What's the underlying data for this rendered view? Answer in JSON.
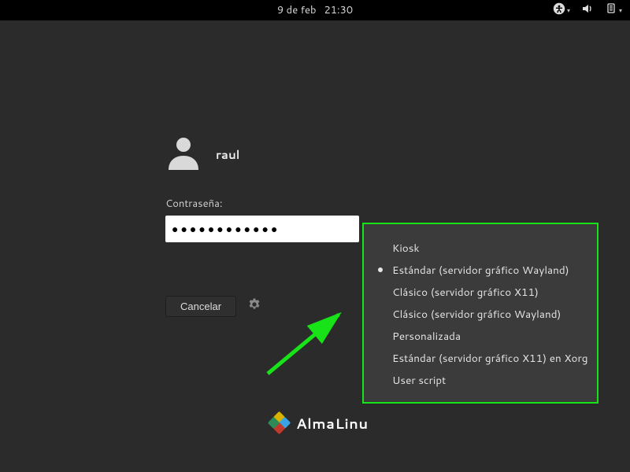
{
  "topbar": {
    "date": "9 de feb",
    "time": "21:30",
    "icons": {
      "a11y": "accessibility-icon",
      "volume": "volume-icon",
      "power": "power-menu-icon"
    }
  },
  "login": {
    "username": "raul",
    "password_label": "Contraseña:",
    "password_value": "●●●●●●●●●●●●",
    "cancel_label": "Cancelar"
  },
  "sessions": {
    "selected_index": 1,
    "items": [
      "Kiosk",
      "Estándar (servidor gráfico Wayland)",
      "Clásico (servidor gráfico X11)",
      "Clásico (servidor gráfico Wayland)",
      "Personalizada",
      "Estándar (servidor gráfico X11) en Xorg",
      "User script"
    ]
  },
  "brand": {
    "name": "AlmaLinux",
    "visible_text": "AlmaLinu"
  },
  "annotation": {
    "arrow_color": "#18e218",
    "popup_border": "#18e218"
  }
}
